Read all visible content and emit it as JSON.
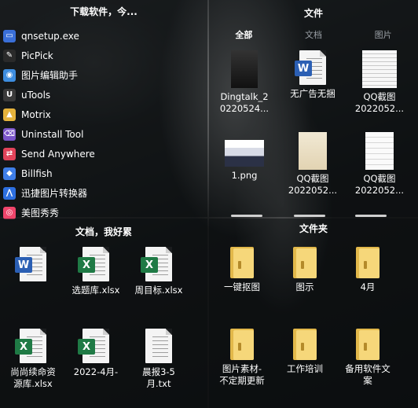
{
  "downloads": {
    "title": "下载软件，今...",
    "apps": [
      {
        "label": "qnsetup.exe",
        "icon": "monitor-icon",
        "color": "#3a6fd8"
      },
      {
        "label": "PicPick",
        "icon": "picpick-icon",
        "color": "#2a2a2a"
      },
      {
        "label": "图片编辑助手",
        "icon": "image-editor-icon",
        "color": "#3d8de0"
      },
      {
        "label": "uTools",
        "icon": "utools-icon",
        "color": "#3a3a3a"
      },
      {
        "label": "Motrix",
        "icon": "motrix-icon",
        "color": "#e5b33c"
      },
      {
        "label": "Uninstall Tool",
        "icon": "uninstall-tool-icon",
        "color": "#7a55c9"
      },
      {
        "label": "Send Anywhere",
        "icon": "send-anywhere-icon",
        "color": "#e2435a"
      },
      {
        "label": "Billfish",
        "icon": "billfish-icon",
        "color": "#3f7ee8"
      },
      {
        "label": "迅捷图片转换器",
        "icon": "image-converter-icon",
        "color": "#2d6fe0"
      },
      {
        "label": "美图秀秀",
        "icon": "meitu-icon",
        "color": "#f0456b"
      }
    ]
  },
  "files": {
    "title": "文件",
    "tabs": [
      "全部",
      "文档",
      "图片"
    ],
    "active_tab": "全部",
    "items": [
      {
        "name": "Dingtalk_2\n0220524...",
        "kind": "dark-image"
      },
      {
        "name": "无广告无捆",
        "kind": "word"
      },
      {
        "name": "QQ截图\n2022052...",
        "kind": "screenshot"
      },
      {
        "name": "1.png",
        "kind": "screenshot-wide"
      },
      {
        "name": "QQ截图\n2022052...",
        "kind": "screenshot-poster"
      },
      {
        "name": "QQ截图\n2022052...",
        "kind": "screenshot-light"
      }
    ]
  },
  "documents": {
    "title": "文档，我好累",
    "items": [
      {
        "name": "",
        "kind": "word"
      },
      {
        "name": "选题库.xlsx",
        "kind": "excel"
      },
      {
        "name": "周目标.xlsx",
        "kind": "excel"
      },
      {
        "name": "尚尚续命资\n源库.xlsx",
        "kind": "excel"
      },
      {
        "name": "2022-4月-",
        "kind": "excel"
      },
      {
        "name": "晨报3-5\n月.txt",
        "kind": "text"
      }
    ]
  },
  "folders": {
    "title": "文件夹",
    "items": [
      {
        "name": "一键抠图"
      },
      {
        "name": "图示"
      },
      {
        "name": "4月"
      },
      {
        "name": "图片素材-\n不定期更新"
      },
      {
        "name": "工作培训"
      },
      {
        "name": "备用软件文\n案"
      }
    ]
  },
  "colors": {
    "word": "#2b5fb4",
    "excel": "#1f7a45",
    "folder": "#f6d77a"
  }
}
